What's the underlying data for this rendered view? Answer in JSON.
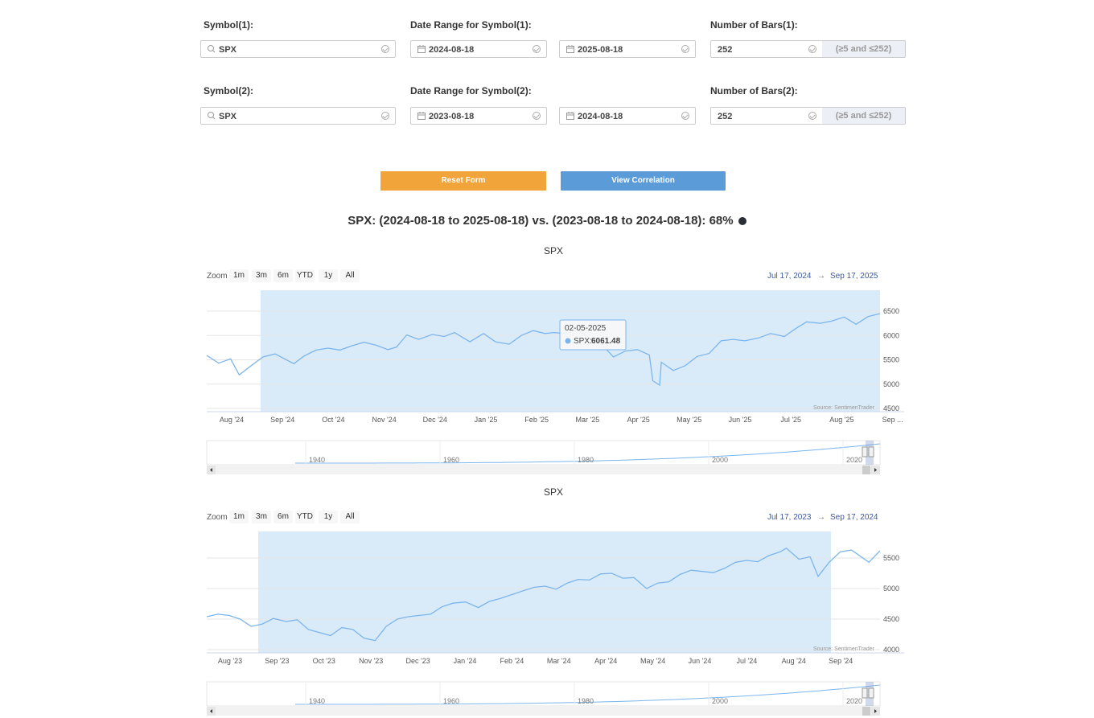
{
  "form": {
    "row1": {
      "symbol_label": "Symbol(1):",
      "symbol_value": "SPX",
      "date_label": "Date Range for Symbol(1):",
      "date_start": "2024-08-18",
      "date_end": "2025-08-18",
      "bars_label": "Number of Bars(1):",
      "bars_value": "252",
      "bars_hint": "(≥5 and ≤252)"
    },
    "row2": {
      "symbol_label": "Symbol(2):",
      "symbol_value": "SPX",
      "date_label": "Date Range for Symbol(2):",
      "date_start": "2023-08-18",
      "date_end": "2024-08-18",
      "bars_label": "Number of Bars(2):",
      "bars_value": "252",
      "bars_hint": "(≥5 and ≤252)"
    },
    "reset_label": "Reset Form",
    "view_label": "View Correlation",
    "reset_color": "#f0a43a",
    "view_color": "#5b9bd8"
  },
  "correlation": {
    "title": "SPX: (2024-08-18 to 2025-08-18) vs. (2023-08-18 to 2024-08-18): 68%"
  },
  "zoom": {
    "label": "Zoom",
    "buttons": [
      "1m",
      "3m",
      "6m",
      "YTD",
      "1y",
      "All"
    ]
  },
  "chart_data": [
    {
      "type": "line",
      "title": "SPX",
      "range_from": "Jul 17, 2024",
      "range_to": "Sep 17, 2025",
      "range_sep": "→",
      "credits": "Source: SentimenTrader",
      "x_ticks": [
        "Aug '24",
        "Sep '24",
        "Oct '24",
        "Nov '24",
        "Dec '24",
        "Jan '25",
        "Feb '25",
        "Mar '25",
        "Apr '25",
        "May '25",
        "Jun '25",
        "Jul '25",
        "Aug '25",
        "Sep ..."
      ],
      "y_ticks": [
        "6500",
        "6000",
        "5500",
        "5000",
        "4500"
      ],
      "ylim": [
        4500,
        6500
      ],
      "series": [
        {
          "name": "SPX",
          "color": "#7cb5ec",
          "x": [
            "2024-07-17",
            "2024-07-24",
            "2024-07-31",
            "2024-08-05",
            "2024-08-12",
            "2024-08-19",
            "2024-08-26",
            "2024-09-06",
            "2024-09-12",
            "2024-09-19",
            "2024-09-26",
            "2024-10-03",
            "2024-10-10",
            "2024-10-17",
            "2024-10-24",
            "2024-10-31",
            "2024-11-05",
            "2024-11-11",
            "2024-11-18",
            "2024-11-26",
            "2024-12-03",
            "2024-12-09",
            "2024-12-18",
            "2024-12-26",
            "2025-01-02",
            "2025-01-10",
            "2025-01-17",
            "2025-01-24",
            "2025-01-31",
            "2025-02-05",
            "2025-02-12",
            "2025-02-19",
            "2025-02-26",
            "2025-03-05",
            "2025-03-12",
            "2025-03-19",
            "2025-03-26",
            "2025-04-02",
            "2025-04-04",
            "2025-04-08",
            "2025-04-09",
            "2025-04-16",
            "2025-04-23",
            "2025-04-30",
            "2025-05-07",
            "2025-05-14",
            "2025-05-21",
            "2025-05-28",
            "2025-06-05",
            "2025-06-12",
            "2025-06-20",
            "2025-06-27",
            "2025-07-03",
            "2025-07-11",
            "2025-07-18",
            "2025-07-25",
            "2025-08-01",
            "2025-08-08",
            "2025-08-15"
          ],
          "values": [
            5590,
            5430,
            5520,
            5190,
            5380,
            5560,
            5620,
            5420,
            5580,
            5700,
            5740,
            5700,
            5790,
            5860,
            5800,
            5710,
            5760,
            6010,
            5920,
            6020,
            5980,
            6060,
            5870,
            6040,
            5870,
            5820,
            6000,
            6100,
            6040,
            6061,
            6040,
            6120,
            5950,
            5820,
            5560,
            5680,
            5710,
            5600,
            5070,
            4980,
            5450,
            5280,
            5380,
            5570,
            5630,
            5890,
            5920,
            5890,
            5950,
            6040,
            5980,
            6150,
            6280,
            6250,
            6300,
            6380,
            6230,
            6390,
            6450
          ]
        }
      ],
      "tooltip": {
        "date": "02-05-2025",
        "series": "SPX",
        "value": "6061.48"
      },
      "navigator_ticks": [
        "1940",
        "1960",
        "1980",
        "2000",
        "2020"
      ]
    },
    {
      "type": "line",
      "title": "SPX",
      "range_from": "Jul 17, 2023",
      "range_to": "Sep 17, 2024",
      "range_sep": "→",
      "credits": "Source: SentimenTrader",
      "x_ticks": [
        "Aug '23",
        "Sep '23",
        "Oct '23",
        "Nov '23",
        "Dec '23",
        "Jan '24",
        "Feb '24",
        "Mar '24",
        "Apr '24",
        "May '24",
        "Jun '24",
        "Jul '24",
        "Aug '24",
        "Sep '24"
      ],
      "y_ticks": [
        "5500",
        "5000",
        "4500",
        "4000"
      ],
      "ylim": [
        4000,
        5500
      ],
      "series": [
        {
          "name": "SPX",
          "color": "#7cb5ec",
          "x": [
            "2023-07-17",
            "2023-07-24",
            "2023-07-31",
            "2023-08-07",
            "2023-08-14",
            "2023-08-21",
            "2023-08-28",
            "2023-09-05",
            "2023-09-12",
            "2023-09-19",
            "2023-09-26",
            "2023-10-03",
            "2023-10-10",
            "2023-10-17",
            "2023-10-24",
            "2023-10-31",
            "2023-11-07",
            "2023-11-14",
            "2023-11-21",
            "2023-11-28",
            "2023-12-05",
            "2023-12-12",
            "2023-12-19",
            "2023-12-27",
            "2024-01-04",
            "2024-01-11",
            "2024-01-18",
            "2024-01-25",
            "2024-02-01",
            "2024-02-08",
            "2024-02-15",
            "2024-02-22",
            "2024-02-29",
            "2024-03-07",
            "2024-03-14",
            "2024-03-21",
            "2024-03-28",
            "2024-04-04",
            "2024-04-11",
            "2024-04-19",
            "2024-04-26",
            "2024-05-03",
            "2024-05-10",
            "2024-05-17",
            "2024-05-24",
            "2024-05-31",
            "2024-06-07",
            "2024-06-14",
            "2024-06-21",
            "2024-06-28",
            "2024-07-05",
            "2024-07-12",
            "2024-07-16",
            "2024-07-24",
            "2024-07-31",
            "2024-08-05",
            "2024-08-12",
            "2024-08-19",
            "2024-08-26",
            "2024-09-06",
            "2024-09-13"
          ],
          "values": [
            4540,
            4580,
            4560,
            4500,
            4380,
            4420,
            4510,
            4460,
            4490,
            4330,
            4280,
            4230,
            4360,
            4330,
            4190,
            4150,
            4380,
            4500,
            4540,
            4560,
            4580,
            4700,
            4760,
            4780,
            4690,
            4790,
            4840,
            4900,
            4960,
            5020,
            5040,
            4990,
            5090,
            5150,
            5140,
            5240,
            5250,
            5170,
            5180,
            5000,
            5090,
            5110,
            5230,
            5300,
            5280,
            5260,
            5330,
            5430,
            5460,
            5440,
            5540,
            5600,
            5660,
            5480,
            5520,
            5200,
            5430,
            5600,
            5630,
            5430,
            5620
          ]
        }
      ],
      "navigator_ticks": [
        "1940",
        "1960",
        "1980",
        "2000",
        "2020"
      ]
    }
  ]
}
